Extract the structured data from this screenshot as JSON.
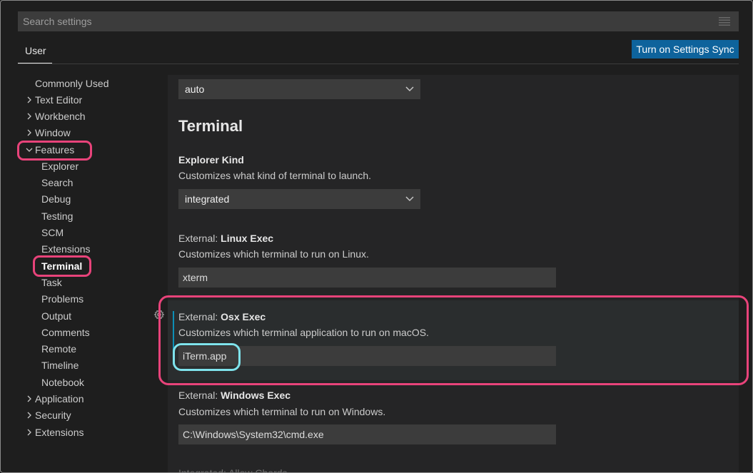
{
  "search": {
    "placeholder": "Search settings",
    "filter_icon": "filter-list-icon"
  },
  "header": {
    "tab_user": "User",
    "sync_button": "Turn on Settings Sync"
  },
  "tree": {
    "items": [
      {
        "label": "Commonly Used",
        "level": 1,
        "chevron": "none"
      },
      {
        "label": "Text Editor",
        "level": 1,
        "chevron": "right"
      },
      {
        "label": "Workbench",
        "level": 1,
        "chevron": "right"
      },
      {
        "label": "Window",
        "level": 1,
        "chevron": "right"
      },
      {
        "label": "Features",
        "level": 1,
        "chevron": "down"
      },
      {
        "label": "Explorer",
        "level": 2
      },
      {
        "label": "Search",
        "level": 2
      },
      {
        "label": "Debug",
        "level": 2
      },
      {
        "label": "Testing",
        "level": 2
      },
      {
        "label": "SCM",
        "level": 2
      },
      {
        "label": "Extensions",
        "level": 2
      },
      {
        "label": "Terminal",
        "level": 2,
        "selected": true
      },
      {
        "label": "Task",
        "level": 2
      },
      {
        "label": "Problems",
        "level": 2
      },
      {
        "label": "Output",
        "level": 2
      },
      {
        "label": "Comments",
        "level": 2
      },
      {
        "label": "Remote",
        "level": 2
      },
      {
        "label": "Timeline",
        "level": 2
      },
      {
        "label": "Notebook",
        "level": 2
      },
      {
        "label": "Application",
        "level": 1,
        "chevron": "right"
      },
      {
        "label": "Security",
        "level": 1,
        "chevron": "right"
      },
      {
        "label": "Extensions",
        "level": 1,
        "chevron": "right"
      }
    ]
  },
  "main": {
    "top_select_value": "auto",
    "section_title": "Terminal",
    "explorer_kind": {
      "title_key": "Explorer Kind",
      "description": "Customizes what kind of terminal to launch.",
      "value": "integrated"
    },
    "linux_exec": {
      "title_prefix": "External: ",
      "title_key": "Linux Exec",
      "description": "Customizes which terminal to run on Linux.",
      "value": "xterm"
    },
    "osx_exec": {
      "title_prefix": "External: ",
      "title_key": "Osx Exec",
      "description": "Customizes which terminal application to run on macOS.",
      "value": "iTerm.app"
    },
    "windows_exec": {
      "title_prefix": "External: ",
      "title_key": "Windows Exec",
      "description": "Customizes which terminal to run on Windows.",
      "value": "C:\\Windows\\System32\\cmd.exe"
    },
    "next_setting_partial": "Integrated: Allow Chords"
  },
  "colors": {
    "highlight_pink": "#e8437a",
    "highlight_cyan": "#7fe3ec",
    "sync_button": "#0e639c",
    "focus_bar": "#0d8fb5"
  }
}
